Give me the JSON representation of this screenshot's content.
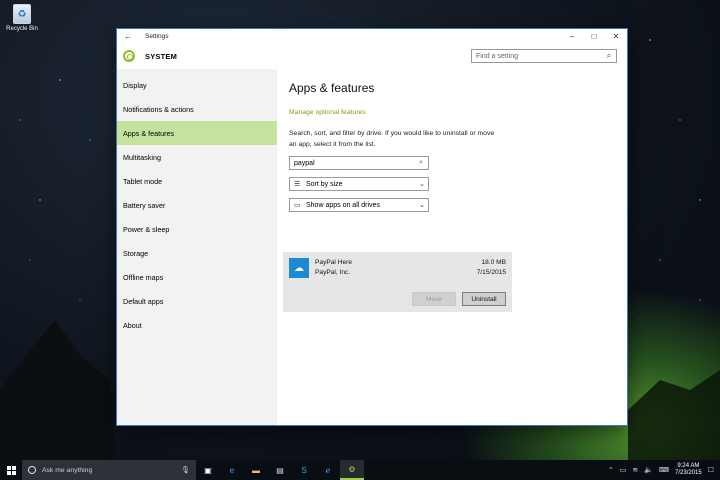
{
  "desktop": {
    "recycle_bin_label": "Recycle Bin"
  },
  "window": {
    "title": "Settings",
    "section": "SYSTEM",
    "search_placeholder": "Find a setting",
    "controls": {
      "back": "←",
      "minimize": "–",
      "maximize": "□",
      "close": "✕"
    }
  },
  "sidebar": {
    "items": [
      {
        "label": "Display"
      },
      {
        "label": "Notifications & actions"
      },
      {
        "label": "Apps & features"
      },
      {
        "label": "Multitasking"
      },
      {
        "label": "Tablet mode"
      },
      {
        "label": "Battery saver"
      },
      {
        "label": "Power & sleep"
      },
      {
        "label": "Storage"
      },
      {
        "label": "Offline maps"
      },
      {
        "label": "Default apps"
      },
      {
        "label": "About"
      }
    ],
    "active_index": 2
  },
  "main": {
    "heading": "Apps & features",
    "optional_link": "Manage optional features",
    "description": "Search, sort, and filter by drive. If you would like to uninstall or move an app, select it from the list.",
    "search_value": "paypal",
    "sort_label": "Sort by size",
    "drives_label": "Show apps on all drives",
    "app": {
      "name": "PayPal Here",
      "publisher": "PayPal, Inc.",
      "size": "18.0 MB",
      "date": "7/15/2015",
      "move_label": "Move",
      "uninstall_label": "Uninstall"
    }
  },
  "taskbar": {
    "search_placeholder": "Ask me anything",
    "time": "9:24 AM",
    "date": "7/23/2015"
  },
  "colors": {
    "accent": "#8cbf26",
    "active_nav": "#c5e39e",
    "app_icon": "#1a8ad4"
  }
}
